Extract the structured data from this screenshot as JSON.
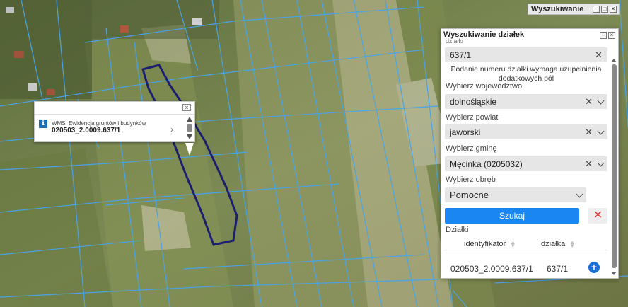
{
  "map": {
    "popup": {
      "layer_name": "WMS, Ewidencja gruntów i budynków",
      "plot_id": "020503_2.0009.637/1"
    }
  },
  "mini_window": {
    "title": "Wyszukiwanie"
  },
  "panel": {
    "title": "Wyszukiwanie działek",
    "cut_label": "działki",
    "plot_number": "637/1",
    "note_line1": "Podanie numeru działki wymaga uzupełnienia",
    "note_line2": "dodatkowych pól",
    "voivodeship_label": "Wybierz województwo",
    "voivodeship_value": "dolnośląskie",
    "county_label": "Wybierz powiat",
    "county_value": "jaworski",
    "commune_label": "Wybierz gminę",
    "commune_value": "Męcinka (0205032)",
    "precinct_label": "Wybierz obręb",
    "precinct_value": "Pomocne",
    "search_label": "Szukaj",
    "clear_symbol": "✕",
    "results_label": "Działki",
    "table": {
      "columns": [
        "identyfikator",
        "działka"
      ],
      "rows": [
        {
          "id": "020503_2.0009.637/1",
          "plot": "637/1"
        }
      ]
    }
  },
  "colors": {
    "accent": "#1a86f2",
    "parcel_outline": "#1c1f6e",
    "parcel_lines": "#4aa3e6"
  }
}
